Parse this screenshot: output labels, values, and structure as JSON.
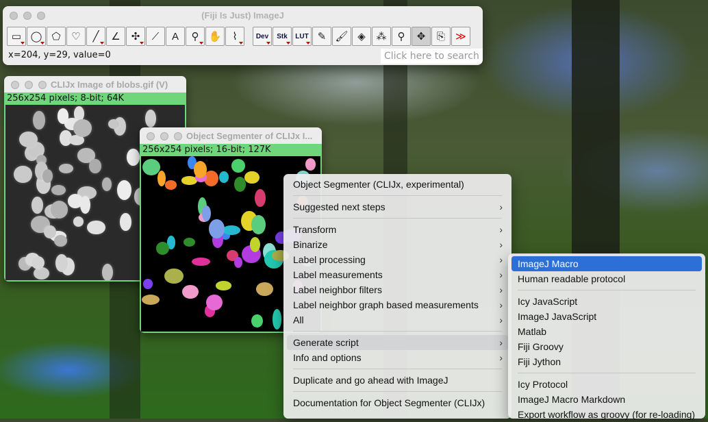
{
  "imagej": {
    "title": "(Fiji Is Just) ImageJ",
    "status": "x=204, y=29, value=0",
    "search_placeholder": "Click here to search",
    "tools": [
      {
        "name": "rectangle-tool-icon",
        "glyph": "▭",
        "dd": true
      },
      {
        "name": "oval-tool-icon",
        "glyph": "◯",
        "dd": true
      },
      {
        "name": "polygon-tool-icon",
        "glyph": "⬠",
        "dd": false
      },
      {
        "name": "freehand-tool-icon",
        "glyph": "♡",
        "dd": false
      },
      {
        "name": "line-tool-icon",
        "glyph": "╱",
        "dd": true
      },
      {
        "name": "angle-tool-icon",
        "glyph": "∠",
        "dd": false
      },
      {
        "name": "multipoint-tool-icon",
        "glyph": "✣",
        "dd": true
      },
      {
        "name": "wand-tool-icon",
        "glyph": "⟋",
        "dd": false
      },
      {
        "name": "text-tool-icon",
        "glyph": "A",
        "dd": false
      },
      {
        "name": "zoom-tool-icon",
        "glyph": "⚲",
        "dd": true
      },
      {
        "name": "hand-tool-icon",
        "glyph": "✋",
        "dd": false
      },
      {
        "name": "dropper-tool-icon",
        "glyph": "⌇",
        "dd": true
      }
    ],
    "tools2": [
      {
        "name": "dev-menu-button",
        "glyph": "Dev",
        "dd": true,
        "small": true
      },
      {
        "name": "stk-menu-button",
        "glyph": "Stk",
        "dd": true,
        "small": true
      },
      {
        "name": "lut-menu-button",
        "glyph": "LUT",
        "dd": true,
        "small": true
      },
      {
        "name": "pencil-tool-icon",
        "glyph": "✎",
        "dd": false
      },
      {
        "name": "brush-tool-icon",
        "glyph": "🖌",
        "dd": false
      },
      {
        "name": "flood-fill-tool-icon",
        "glyph": "◈",
        "dd": false
      },
      {
        "name": "clij-tool-icon",
        "glyph": "⁂",
        "dd": false
      },
      {
        "name": "magnifier-tool-icon",
        "glyph": "⚲",
        "dd": false
      },
      {
        "name": "move-tool-icon",
        "glyph": "✥",
        "dd": false,
        "sel": true
      },
      {
        "name": "annotation-tool-icon",
        "glyph": "⎘",
        "dd": false
      },
      {
        "name": "more-tools-icon",
        "glyph": "≫",
        "dd": false,
        "red": true
      }
    ]
  },
  "blobs_window": {
    "title": "CLIJx Image of blobs.gif (V)",
    "info": "256x254 pixels; 8-bit; 64K"
  },
  "segmenter_window": {
    "title": "Object Segmenter of CLIJx I...",
    "info": "256x254 pixels; 16-bit; 127K"
  },
  "context_menu": {
    "items": [
      {
        "label": "Object Segmenter (CLIJx, experimental)",
        "sub": false
      },
      {
        "sep": true
      },
      {
        "label": "Suggested next steps",
        "sub": true
      },
      {
        "sep": true
      },
      {
        "label": "Transform",
        "sub": true
      },
      {
        "label": "Binarize",
        "sub": true
      },
      {
        "label": "Label processing",
        "sub": true
      },
      {
        "label": "Label measurements",
        "sub": true
      },
      {
        "label": "Label neighbor filters",
        "sub": true
      },
      {
        "label": "Label neighbor graph based measurements",
        "sub": true
      },
      {
        "label": "All",
        "sub": true
      },
      {
        "sep": true
      },
      {
        "label": "Generate script",
        "sub": true,
        "hl": true
      },
      {
        "label": "Info and options",
        "sub": true
      },
      {
        "sep": true
      },
      {
        "label": "Duplicate and go ahead with ImageJ",
        "sub": false
      },
      {
        "sep": true
      },
      {
        "label": "Documentation for Object Segmenter (CLIJx)",
        "sub": false
      }
    ]
  },
  "script_submenu": {
    "items": [
      {
        "label": "ImageJ Macro",
        "sel": true
      },
      {
        "label": "Human readable protocol"
      },
      {
        "sep": true
      },
      {
        "label": "Icy JavaScript"
      },
      {
        "label": "ImageJ JavaScript"
      },
      {
        "label": "Matlab"
      },
      {
        "label": "Fiji Groovy"
      },
      {
        "label": "Fiji Jython"
      },
      {
        "sep": true
      },
      {
        "label": "Icy Protocol"
      },
      {
        "label": "ImageJ Macro Markdown"
      },
      {
        "label": "Export workflow as groovy (for re-loading)"
      }
    ]
  },
  "colors": {
    "window_info_green": "#6fd67b",
    "menu_selection_blue": "#2c6fd6"
  }
}
